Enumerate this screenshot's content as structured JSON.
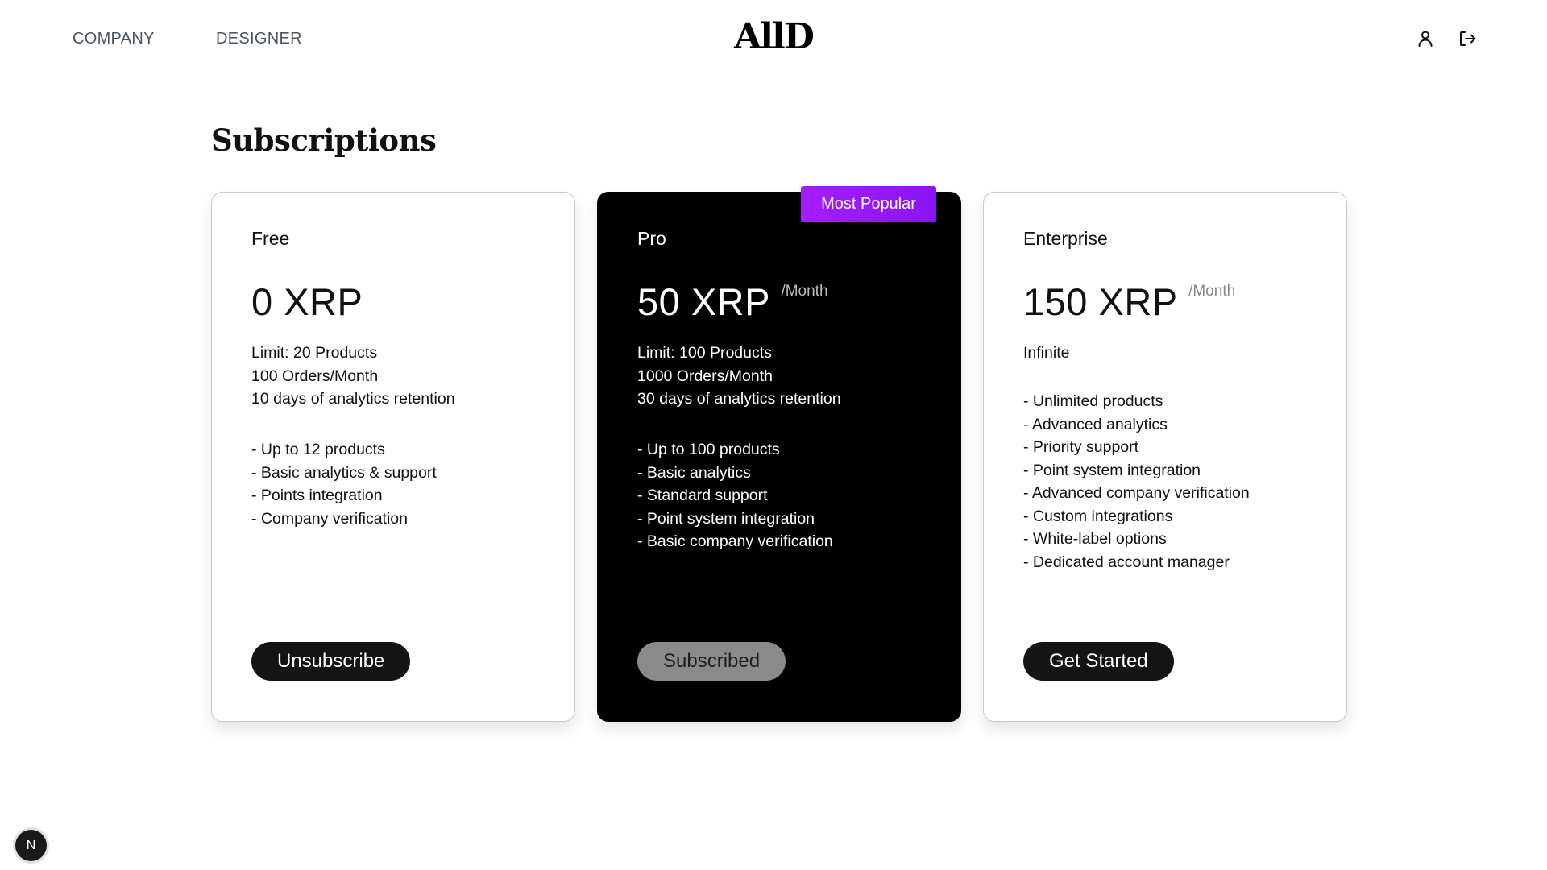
{
  "nav": {
    "company_label": "COMPANY",
    "designer_label": "DESIGNER",
    "logo_text": "AllD",
    "user_icon": "user-icon",
    "logout_icon": "logout-icon"
  },
  "page": {
    "title": "Subscriptions"
  },
  "plans": [
    {
      "name": "Free",
      "price": "0 XRP",
      "period": "",
      "limits": [
        "Limit: 20 Products",
        "100 Orders/Month",
        "10 days of analytics retention"
      ],
      "features": [
        "- Up to 12 products",
        "- Basic analytics & support",
        "- Points integration",
        "- Company verification"
      ],
      "button_label": "Unsubscribe"
    },
    {
      "name": "Pro",
      "price": "50 XRP",
      "period": "/Month",
      "badge": "Most Popular",
      "limits": [
        "Limit: 100 Products",
        "1000 Orders/Month",
        "30 days of analytics retention"
      ],
      "features": [
        "- Up to 100 products",
        "- Basic analytics",
        "- Standard support",
        "- Point system integration",
        "- Basic company verification"
      ],
      "button_label": "Subscribed"
    },
    {
      "name": "Enterprise",
      "price": "150 XRP",
      "period": "/Month",
      "limits": [
        "Infinite"
      ],
      "features": [
        "- Unlimited products",
        "- Advanced analytics",
        "- Priority support",
        "- Point system integration",
        "- Advanced company verification",
        "- Custom integrations",
        "- White-label options",
        "- Dedicated account manager"
      ],
      "button_label": "Get Started"
    }
  ],
  "dev_indicator": {
    "label": "N"
  },
  "colors": {
    "badge_gradient_start": "#a51dff",
    "badge_gradient_end": "#8a14f5",
    "dark_card": "#000000",
    "button_dark": "#141414",
    "button_subscribed": "#8a8a8a"
  }
}
